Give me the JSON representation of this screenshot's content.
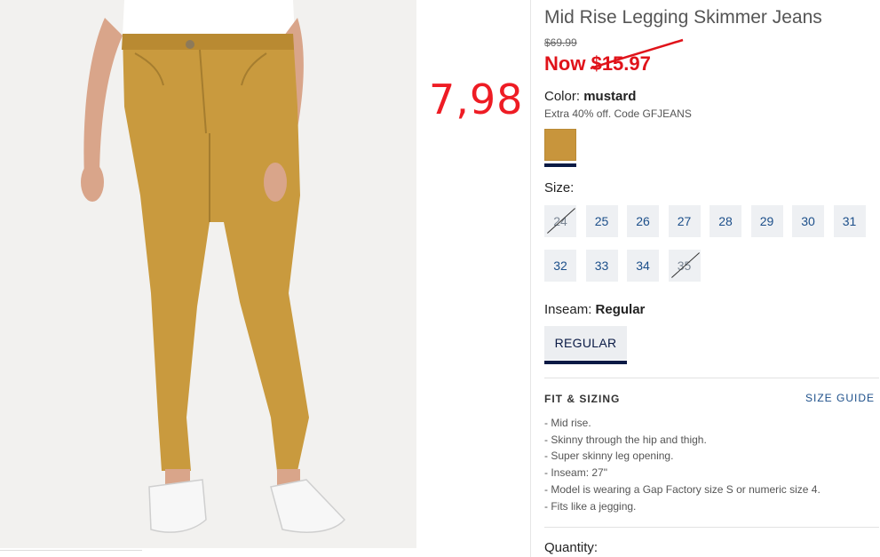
{
  "product": {
    "title": "Mid Rise Legging Skimmer Jeans",
    "was_price": "$69.99",
    "now_label": "Now",
    "now_price": "$15.97",
    "color_label": "Color:",
    "color_value": "mustard",
    "promo": "Extra 40% off. Code GFJEANS",
    "swatch_color": "#c8953c"
  },
  "annotation": {
    "price_text": "7,98",
    "color": "#ee1c24"
  },
  "size": {
    "label": "Size:",
    "options": [
      {
        "label": "24",
        "available": false
      },
      {
        "label": "25",
        "available": true
      },
      {
        "label": "26",
        "available": true
      },
      {
        "label": "27",
        "available": true
      },
      {
        "label": "28",
        "available": true
      },
      {
        "label": "29",
        "available": true
      },
      {
        "label": "30",
        "available": true
      },
      {
        "label": "31",
        "available": true
      },
      {
        "label": "32",
        "available": true
      },
      {
        "label": "33",
        "available": true
      },
      {
        "label": "34",
        "available": true
      },
      {
        "label": "35",
        "available": false
      }
    ]
  },
  "inseam": {
    "label": "Inseam:",
    "value": "Regular",
    "button": "REGULAR"
  },
  "fit": {
    "title": "FIT & SIZING",
    "size_guide": "SIZE GUIDE",
    "bullets": [
      "Mid rise.",
      "Skinny through the hip and thigh.",
      "Super skinny leg opening.",
      "Inseam: 27\"",
      "Model is wearing a Gap Factory size S or numeric size 4.",
      "Fits like a jegging."
    ]
  },
  "quantity_label": "Quantity:",
  "colors": {
    "accent_navy": "#0a1a45",
    "sale_red": "#e0131a",
    "link_blue": "#1c4f8a"
  }
}
